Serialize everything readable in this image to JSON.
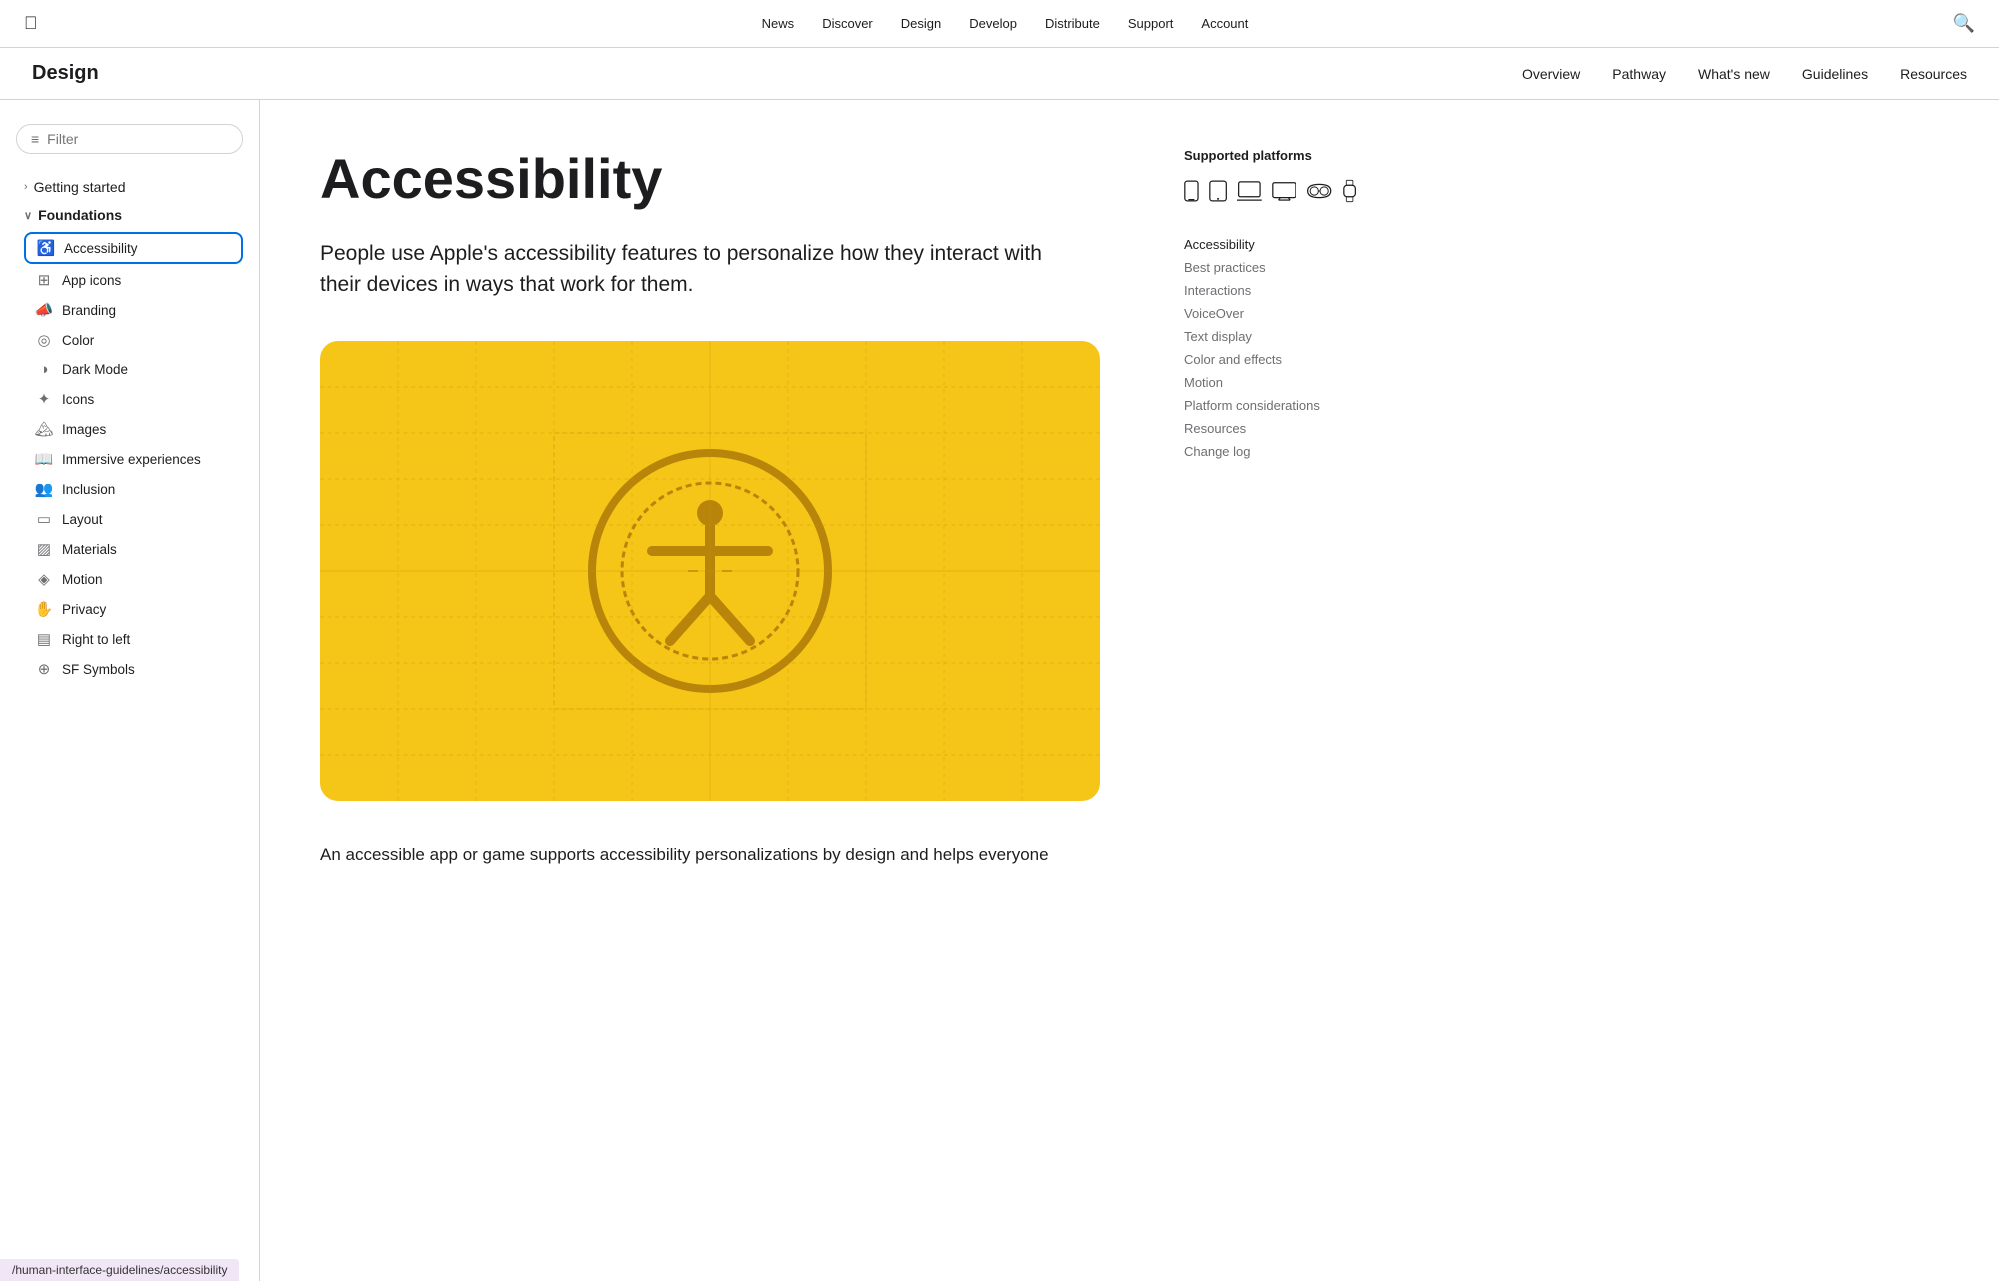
{
  "topnav": {
    "logo": "",
    "links": [
      "News",
      "Discover",
      "Design",
      "Develop",
      "Distribute",
      "Support",
      "Account"
    ]
  },
  "subnav": {
    "title": "Design",
    "links": [
      "Overview",
      "Pathway",
      "What's new",
      "Guidelines",
      "Resources"
    ]
  },
  "sidebar": {
    "filter_placeholder": "Filter",
    "filter_icon": "≡",
    "getting_started": "Getting started",
    "foundations_label": "Foundations",
    "items": [
      {
        "label": "Accessibility",
        "icon": "♿",
        "active": true
      },
      {
        "label": "App icons",
        "icon": "🔲"
      },
      {
        "label": "Branding",
        "icon": "📣"
      },
      {
        "label": "Color",
        "icon": "◎"
      },
      {
        "label": "Dark Mode",
        "icon": "◑"
      },
      {
        "label": "Icons",
        "icon": "✦"
      },
      {
        "label": "Images",
        "icon": "🖼"
      },
      {
        "label": "Immersive experiences",
        "icon": "📖"
      },
      {
        "label": "Inclusion",
        "icon": "👥"
      },
      {
        "label": "Layout",
        "icon": "▭"
      },
      {
        "label": "Materials",
        "icon": "▨"
      },
      {
        "label": "Motion",
        "icon": "◈"
      },
      {
        "label": "Privacy",
        "icon": "✋"
      },
      {
        "label": "Right to left",
        "icon": "▤"
      },
      {
        "label": "SF Symbols",
        "icon": "⊕"
      }
    ]
  },
  "main": {
    "page_title": "Accessibility",
    "page_intro": "People use Apple's accessibility features to personalize how they interact with their devices in ways that work for them.",
    "bottom_text": "An accessible app or game supports accessibility personalizations by design and helps everyone"
  },
  "right_panel": {
    "supported_platforms_label": "Supported platforms",
    "toc": [
      {
        "label": "Accessibility",
        "active": true
      },
      {
        "label": "Best practices"
      },
      {
        "label": "Interactions"
      },
      {
        "label": "VoiceOver"
      },
      {
        "label": "Text display"
      },
      {
        "label": "Color and effects"
      },
      {
        "label": "Motion"
      },
      {
        "label": "Platform considerations"
      },
      {
        "label": "Resources"
      },
      {
        "label": "Change log"
      }
    ]
  },
  "url_bar": "/human-interface-guidelines/accessibility"
}
